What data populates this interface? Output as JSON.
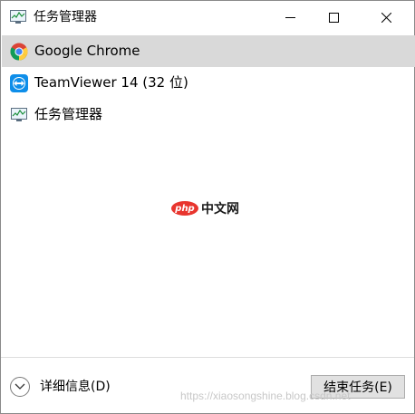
{
  "window": {
    "title": "任务管理器"
  },
  "tasks": [
    {
      "label": "Google Chrome",
      "icon": "chrome-icon",
      "selected": true
    },
    {
      "label": "TeamViewer 14 (32 位)",
      "icon": "teamviewer-icon",
      "selected": false
    },
    {
      "label": "任务管理器",
      "icon": "task-manager-icon",
      "selected": false
    }
  ],
  "center_logo": {
    "badge": "php",
    "text": "中文网"
  },
  "footer": {
    "details_label": "详细信息(D)",
    "end_task_label": "结束任务(E)",
    "watermark": "https://xiaosongshine.blog.csdn.net"
  },
  "colors": {
    "selected_row": "#d9d9d9",
    "php_red": "#e8352e",
    "teamviewer_blue": "#0e8ee9"
  }
}
